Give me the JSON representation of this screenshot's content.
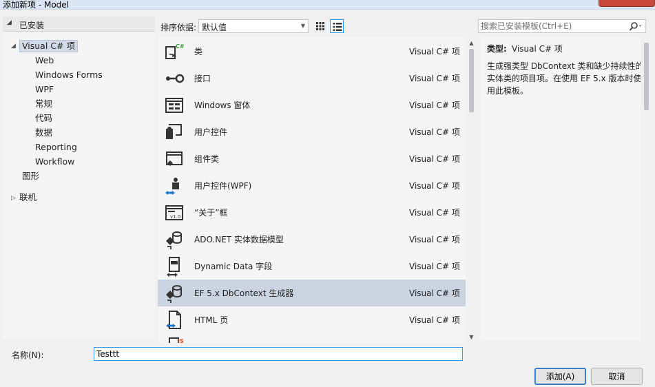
{
  "window": {
    "title": "添加新项 - Model"
  },
  "tree": {
    "header": "已安装",
    "root": "Visual C# 项",
    "children": [
      "Web",
      "Windows Forms",
      "WPF",
      "常规",
      "代码",
      "数据",
      "Reporting",
      "Workflow"
    ],
    "graphics": "图形",
    "online": "联机"
  },
  "toolbar": {
    "sort_label": "排序依据:",
    "sort_value": "默认值",
    "search_placeholder": "搜索已安装模板(Ctrl+E)"
  },
  "templates": [
    {
      "name": "类",
      "type": "Visual C# 项",
      "icon": "class-icon"
    },
    {
      "name": "接口",
      "type": "Visual C# 项",
      "icon": "interface-icon"
    },
    {
      "name": "Windows 窗体",
      "type": "Visual C# 项",
      "icon": "windows-form-icon"
    },
    {
      "name": "用户控件",
      "type": "Visual C# 项",
      "icon": "user-control-icon"
    },
    {
      "name": "组件类",
      "type": "Visual C# 项",
      "icon": "component-class-icon"
    },
    {
      "name": "用户控件(WPF)",
      "type": "Visual C# 项",
      "icon": "wpf-user-control-icon"
    },
    {
      "name": "“关于”框",
      "type": "Visual C# 项",
      "icon": "about-box-icon"
    },
    {
      "name": "ADO.NET 实体数据模型",
      "type": "Visual C# 项",
      "icon": "entity-data-model-icon"
    },
    {
      "name": "Dynamic Data 字段",
      "type": "Visual C# 项",
      "icon": "dynamic-data-field-icon"
    },
    {
      "name": "EF 5.x DbContext 生成器",
      "type": "Visual C# 项",
      "icon": "dbcontext-generator-icon"
    },
    {
      "name": "HTML 页",
      "type": "Visual C# 项",
      "icon": "html-page-icon"
    }
  ],
  "selected_template_index": 9,
  "description": {
    "type_label": "类型:",
    "type_value": "Visual C# 项",
    "text": "生成强类型 DbContext 类和缺少持续性的实体类的项目项。在使用 EF 5.x 版本时使用此模板。"
  },
  "name_field": {
    "label": "名称(N):",
    "value": "Testtt"
  },
  "buttons": {
    "add": "添加(A)",
    "cancel": "取消"
  }
}
